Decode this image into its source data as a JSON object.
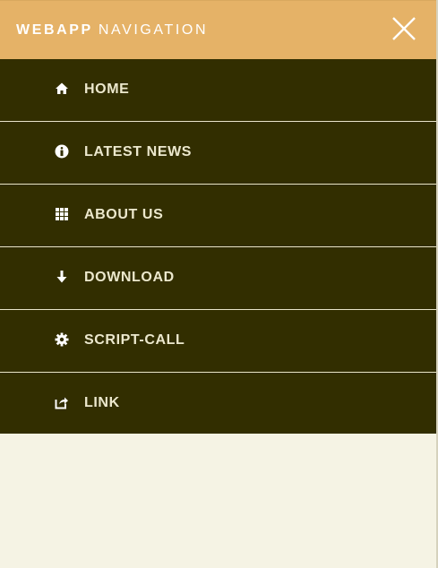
{
  "header": {
    "brand_strong": "WEBAPP",
    "brand_light": "NAVIGATION",
    "close_icon": "close-icon"
  },
  "menu": {
    "items": [
      {
        "label": "HOME",
        "icon": "home-icon"
      },
      {
        "label": "LATEST NEWS",
        "icon": "info-icon"
      },
      {
        "label": "ABOUT US",
        "icon": "grid-icon"
      },
      {
        "label": "DOWNLOAD",
        "icon": "download-arrow-icon"
      },
      {
        "label": "SCRIPT-CALL",
        "icon": "gear-icon"
      },
      {
        "label": "LINK",
        "icon": "external-link-icon"
      }
    ]
  },
  "colors": {
    "header_bg": "#e5b267",
    "menu_bg": "#322e00",
    "menu_text": "#ece8cd",
    "page_bg": "#f5f3e4"
  }
}
